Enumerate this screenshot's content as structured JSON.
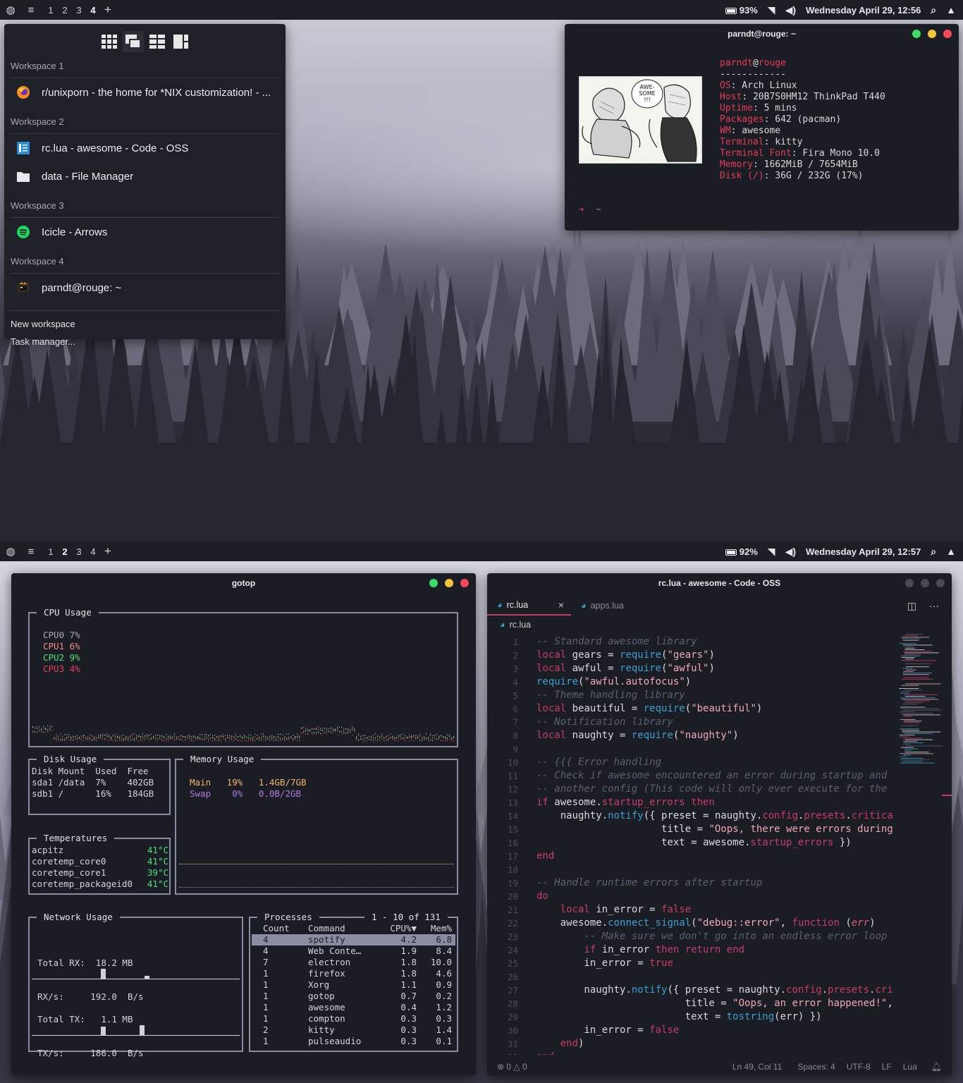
{
  "top": {
    "bar": {
      "workspaces": [
        "1",
        "2",
        "3",
        "4"
      ],
      "active": "4",
      "battery": "93%",
      "datetime": "Wednesday April 29, 12:56"
    },
    "popup": {
      "groups": [
        {
          "title": "Workspace 1",
          "items": [
            {
              "label": "r/unixporn - the home for *NIX customization! - ...",
              "icon": "firefox-icon"
            }
          ]
        },
        {
          "title": "Workspace 2",
          "items": [
            {
              "label": "rc.lua - awesome - Code - OSS",
              "icon": "code-icon"
            },
            {
              "label": "data - File Manager",
              "icon": "folder-icon"
            }
          ]
        },
        {
          "title": "Workspace 3",
          "items": [
            {
              "label": "Icicle - Arrows",
              "icon": "spotify-icon"
            }
          ]
        },
        {
          "title": "Workspace 4",
          "items": [
            {
              "label": "parndt@rouge: ~",
              "icon": "terminal-icon"
            }
          ]
        }
      ],
      "actions": [
        "New workspace",
        "Task manager..."
      ]
    },
    "terminal": {
      "title": "parndt@rouge: ~",
      "user": "parndt",
      "at": "@",
      "host": "rouge",
      "dashes": "------------",
      "info": [
        {
          "k": "OS",
          "v": "Arch Linux"
        },
        {
          "k": "Host",
          "v": "20B7S0HM12 ThinkPad T440"
        },
        {
          "k": "Uptime",
          "v": "5 mins"
        },
        {
          "k": "Packages",
          "v": "642 (pacman)"
        },
        {
          "k": "WM",
          "v": "awesome"
        },
        {
          "k": "Terminal",
          "v": "kitty"
        },
        {
          "k": "Terminal Font",
          "v": "Fira Mono 10.0"
        },
        {
          "k": "Memory",
          "v": "1662MiB / 7654MiB"
        },
        {
          "k": "Disk (/)",
          "v": "36G / 232G (17%)"
        }
      ],
      "prompt_arrow": "➜",
      "prompt_dir": "~",
      "art_text": "AWE-\nSOME\n!!!"
    }
  },
  "bottom": {
    "bar": {
      "workspaces": [
        "1",
        "2",
        "3",
        "4"
      ],
      "active": "2",
      "battery": "92%",
      "datetime": "Wednesday April 29, 12:57"
    },
    "gotop": {
      "title": "gotop",
      "cpu": {
        "label": "CPU Usage",
        "rows": [
          {
            "name": "CPU0",
            "val": "7%",
            "color": "#a8aab4"
          },
          {
            "name": "CPU1",
            "val": "6%",
            "color": "#f08a8a"
          },
          {
            "name": "CPU2",
            "val": "9%",
            "color": "#4ee07c"
          },
          {
            "name": "CPU3",
            "val": "4%",
            "color": "#e0405a"
          }
        ]
      },
      "disk": {
        "label": "Disk Usage",
        "header": [
          "Disk",
          "Mount",
          "Used",
          "Free"
        ],
        "rows": [
          [
            "sda1",
            "/data",
            "7%",
            "402GB"
          ],
          [
            "sdb1",
            "/",
            "16%",
            "184GB"
          ]
        ]
      },
      "mem": {
        "label": "Memory Usage",
        "rows": [
          {
            "name": "Main",
            "pct": "19%",
            "val": "1.4GB/7GB",
            "color": "#f2b36a"
          },
          {
            "name": "Swap",
            "pct": "0%",
            "val": "0.0B/2GB",
            "color": "#b07ae0"
          }
        ]
      },
      "temps": {
        "label": "Temperatures",
        "rows": [
          [
            "acpitz",
            "41°C"
          ],
          [
            "coretemp_core0",
            "41°C"
          ],
          [
            "coretemp_core1",
            "39°C"
          ],
          [
            "coretemp_packageid0",
            "41°C"
          ]
        ]
      },
      "net": {
        "label": "Network Usage",
        "rx_total_label": "Total RX:",
        "rx_total": "18.2 MB",
        "rx_rate_label": "RX/s:",
        "rx_rate": "192.0  B/s",
        "tx_total_label": "Total TX:",
        "tx_total": "1.1 MB",
        "tx_rate_label": "TX/s:",
        "tx_rate": "186.0  B/s"
      },
      "proc": {
        "label": "Processes",
        "range": "1 - 10 of 131",
        "header": [
          "Count",
          "Command",
          "CPU%▼",
          "Mem%"
        ],
        "rows": [
          [
            "4",
            "spotify",
            "4.2",
            "6.8"
          ],
          [
            "4",
            "Web Conte…",
            "1.9",
            "8.4"
          ],
          [
            "7",
            "electron",
            "1.8",
            "10.0"
          ],
          [
            "1",
            "firefox",
            "1.8",
            "4.6"
          ],
          [
            "1",
            "Xorg",
            "1.1",
            "0.9"
          ],
          [
            "1",
            "gotop",
            "0.7",
            "0.2"
          ],
          [
            "1",
            "awesome",
            "0.4",
            "1.2"
          ],
          [
            "1",
            "compton",
            "0.3",
            "0.3"
          ],
          [
            "2",
            "kitty",
            "0.3",
            "1.4"
          ],
          [
            "1",
            "pulseaudio",
            "0.3",
            "0.1"
          ]
        ]
      }
    },
    "code": {
      "title": "rc.lua - awesome - Code - OSS",
      "tabs": [
        "rc.lua",
        "apps.lua"
      ],
      "breadcrumb": "rc.lua",
      "status": {
        "errors": "0",
        "warnings": "0",
        "pos": "Ln 49, Col 11",
        "spaces": "Spaces: 4",
        "enc": "UTF-8",
        "eol": "LF",
        "lang": "Lua"
      }
    }
  }
}
